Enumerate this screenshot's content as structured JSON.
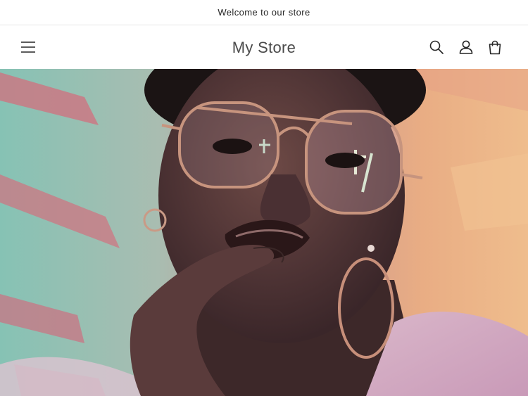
{
  "announcement": {
    "text": "Welcome to our store"
  },
  "header": {
    "logo": "My Store",
    "icons": {
      "menu": "hamburger-menu-icon",
      "search": "search-icon",
      "account": "account-icon",
      "cart": "cart-icon"
    }
  },
  "hero": {
    "image": "portrait-woman-glasses"
  },
  "colors": {
    "text": "#121212",
    "border": "#e6e6e6",
    "background": "#ffffff"
  }
}
